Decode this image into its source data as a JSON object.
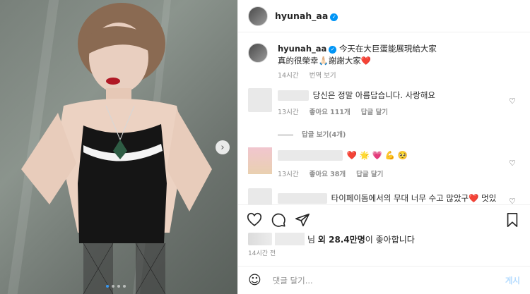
{
  "header": {
    "username": "hyunah_aa",
    "verified_icon": "verified-badge-icon"
  },
  "media": {
    "next_icon": "chevron-right-icon",
    "dot_count": 4,
    "active_dot": 0
  },
  "caption": {
    "username": "hyunah_aa",
    "line1": "今天在大巨蛋能展現給大家",
    "line2": "真的很榮幸🙏🏻謝謝大家❤️",
    "time": "14시간",
    "translate": "번역 보기"
  },
  "comments": [
    {
      "text": "당신은 정말 아름답습니다. 사랑해요",
      "time": "13시간",
      "likes": "좋아요 111개",
      "reply": "답글 달기"
    },
    {
      "view_replies": "답글 보기(4개)"
    },
    {
      "text": "❤️ 🌟 💗 💪 🥺",
      "time": "13시간",
      "likes": "좋아요 38개",
      "reply": "답글 달기"
    },
    {
      "text": "타이페이돔에서의 무대 너무 수고 많았구❤️ 멋있"
    }
  ],
  "likes": {
    "suffix": "님",
    "bold": "외 28.4만명",
    "tail": "이 좋아합니다"
  },
  "post_time": "14시간 전",
  "add_comment": {
    "placeholder": "댓글 달기...",
    "post_label": "게시"
  },
  "colors": {
    "accent": "#0095f6",
    "heart": "#ed4956",
    "muted": "#8e8e8e"
  }
}
